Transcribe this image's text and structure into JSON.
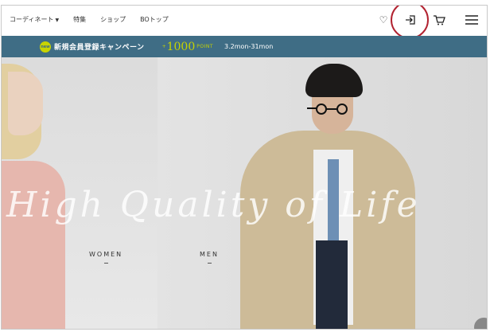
{
  "header": {
    "nav": [
      {
        "label": "コーディネート",
        "has_dropdown": true
      },
      {
        "label": "特集"
      },
      {
        "label": "ショップ"
      },
      {
        "label": "BOトップ"
      }
    ],
    "icons": [
      "heart-icon",
      "login-icon",
      "cart-icon",
      "menu-icon"
    ]
  },
  "banner": {
    "badge": "new",
    "title": "新規会員登録キャンペーン",
    "points_prefix": "+",
    "points_value": "1000",
    "points_unit": "POINT",
    "period": "3.2mon-31mon"
  },
  "hero": {
    "script_text": "High Quality of Life",
    "women_label": "WOMEN",
    "men_label": "MEN"
  },
  "colors": {
    "banner_bg": "#3f6d85",
    "accent_green": "#c8d400",
    "highlight_ring": "#b22331"
  }
}
